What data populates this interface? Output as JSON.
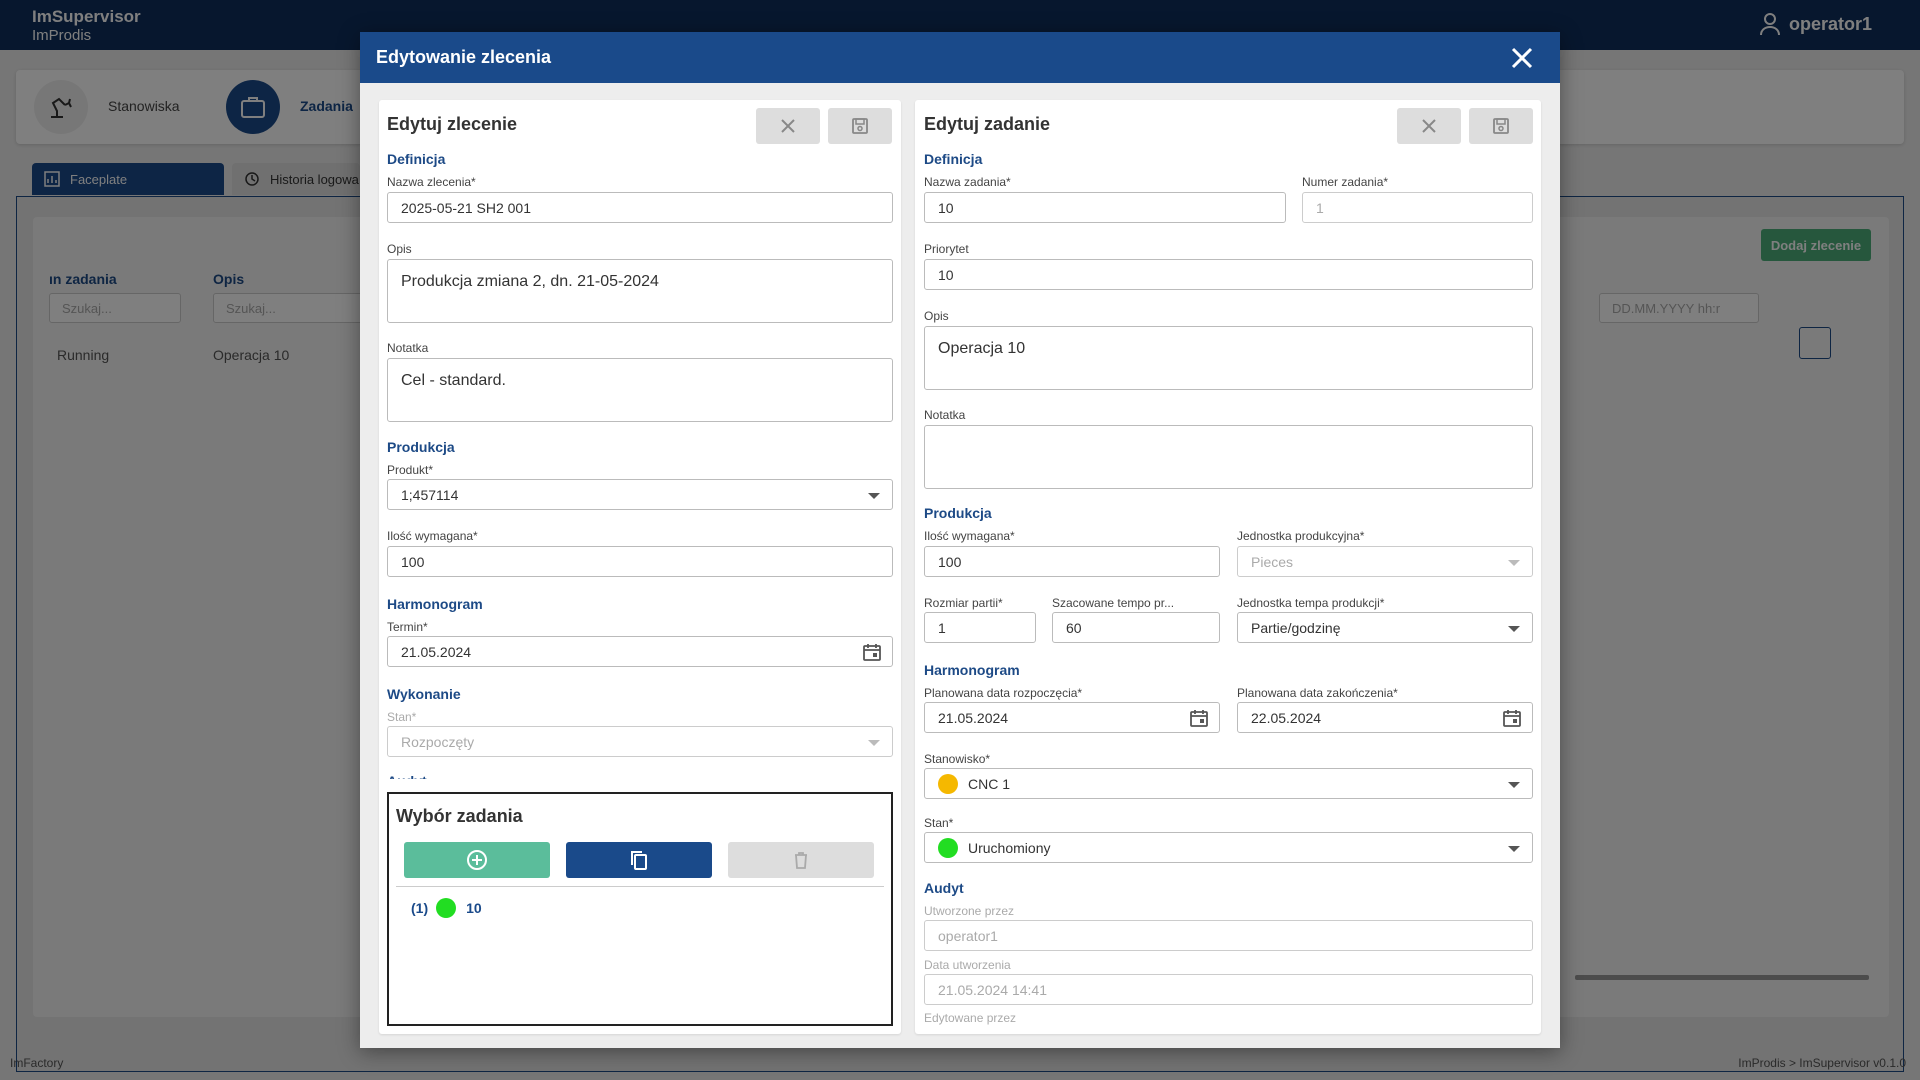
{
  "app": {
    "title": "ImSupervisor",
    "subtitle": "ImProdis",
    "user": "operator1"
  },
  "nav": {
    "stations_label": "Stanowiska",
    "tasks_label": "Zadania"
  },
  "tabs": [
    {
      "label": "Faceplate"
    },
    {
      "label": "Historia logowa"
    }
  ],
  "background": {
    "col_status_header": "ın zadania",
    "col_desc_header": "Opis",
    "search_placeholder_1": "Szukaj...",
    "search_placeholder_2": "Szukaj...",
    "row_status": "Running",
    "row_desc": "Operacja 10",
    "add_order_button": "Dodaj zlecenie",
    "date_placeholder": "DD.MM.YYYY hh:r",
    "date_dash": "-"
  },
  "footer": {
    "left": "ImFactory",
    "right": "ImProdis > ImSupervisor v0.1.0"
  },
  "dialog": {
    "title": "Edytowanie zlecenia"
  },
  "order": {
    "title": "Edytuj zlecenie",
    "definition_title": "Definicja",
    "name_label": "Nazwa zlecenia*",
    "name_value": "2025-05-21 SH2 001",
    "desc_label": "Opis",
    "desc_value": "Produkcja zmiana 2, dn. 21-05-2024",
    "note_label": "Notatka",
    "note_value": "Cel - standard.",
    "production_title": "Produkcja",
    "product_label": "Produkt*",
    "product_value": "1;457114",
    "qty_label": "Ilość wymagana*",
    "qty_value": "100",
    "schedule_title": "Harmonogram",
    "deadline_label": "Termin*",
    "deadline_value": "21.05.2024",
    "execution_title": "Wykonanie",
    "state_label": "Stan*",
    "state_value": "Rozpoczęty",
    "audit_title": "Audyt"
  },
  "task_selection": {
    "title": "Wybór zadania",
    "items": [
      {
        "index": "(1)",
        "label": "10",
        "status_color": "#22dd22"
      }
    ]
  },
  "task": {
    "title": "Edytuj zadanie",
    "definition_title": "Definicja",
    "name_label": "Nazwa zadania*",
    "name_value": "10",
    "number_label": "Numer zadania*",
    "number_value": "1",
    "priority_label": "Priorytet",
    "priority_value": "10",
    "desc_label": "Opis",
    "desc_value": "Operacja 10",
    "note_label": "Notatka",
    "note_value": "",
    "production_title": "Produkcja",
    "qty_label": "Ilość wymagana*",
    "qty_value": "100",
    "unit_label": "Jednostka produkcyjna*",
    "unit_value": "Pieces",
    "batch_label": "Rozmiar partii*",
    "batch_value": "1",
    "rate_label": "Szacowane tempo pr...",
    "rate_value": "60",
    "rate_unit_label": "Jednostka tempa produkcji*",
    "rate_unit_value": "Partie/godzinę",
    "schedule_title": "Harmonogram",
    "start_label": "Planowana data rozpoczęcia*",
    "start_value": "21.05.2024",
    "end_label": "Planowana data zakończenia*",
    "end_value": "22.05.2024",
    "station_label": "Stanowisko*",
    "station_value": "CNC 1",
    "station_color": "#f5b800",
    "state_label": "Stan*",
    "state_value": "Uruchomiony",
    "state_color": "#22dd22",
    "audit_title": "Audyt",
    "created_by_label": "Utworzone przez",
    "created_by_value": "operator1",
    "created_date_label": "Data utworzenia",
    "created_date_value": "21.05.2024 14:41",
    "edited_by_label": "Edytowane przez"
  },
  "colors": {
    "primary": "#1a4a8a",
    "add_button": "#5bbd9b",
    "running": "#22dd22",
    "cnc": "#f5b800"
  }
}
